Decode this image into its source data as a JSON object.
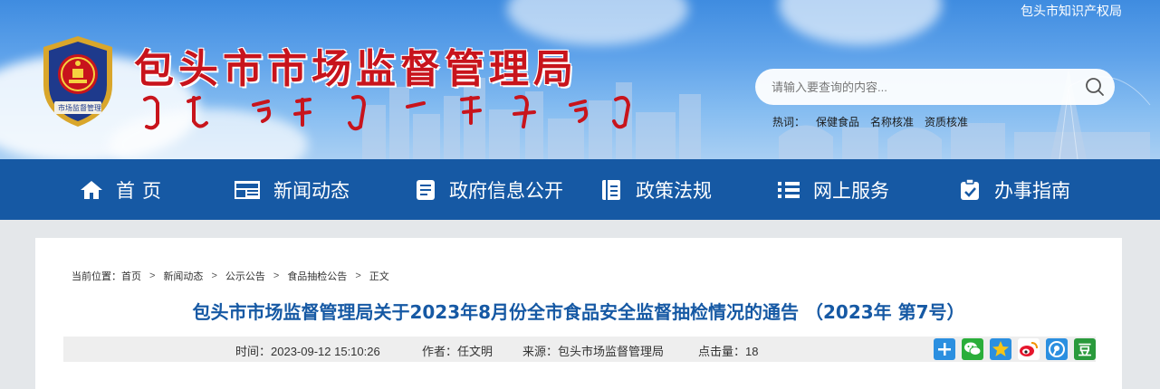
{
  "header": {
    "site_title": "包头市市场监督管理局",
    "emblem_caption": "市场监督管理",
    "ip_link": "包头市知识产权局",
    "search": {
      "placeholder": "请输入要查询的内容..."
    },
    "hotwords": {
      "label": "热词：",
      "items": [
        "保健食品",
        "名称核准",
        "资质核准"
      ]
    }
  },
  "nav": {
    "items": [
      {
        "label": "首页",
        "icon": "home-icon"
      },
      {
        "label": "新闻动态",
        "icon": "news-icon"
      },
      {
        "label": "政府信息公开",
        "icon": "document-icon"
      },
      {
        "label": "政策法规",
        "icon": "book-icon"
      },
      {
        "label": "网上服务",
        "icon": "list-icon"
      },
      {
        "label": "办事指南",
        "icon": "clipboard-icon"
      }
    ]
  },
  "breadcrumb": {
    "label": "当前位置：",
    "items": [
      "首页",
      "新闻动态",
      "公示公告",
      "食品抽检公告",
      "正文"
    ],
    "separator": ">"
  },
  "article": {
    "title": "包头市市场监督管理局关于2023年8月份全市食品安全监督抽检情况的通告 （2023年 第7号）",
    "meta": {
      "time": "时间：2023-09-12 15:10:26",
      "author": "作者：任文明",
      "source": "来源：包头市场监督管理局",
      "clicks": "点击量：18"
    }
  },
  "share": {
    "items": [
      {
        "icon": "plus-share-icon",
        "color": "#2b8fe0"
      },
      {
        "icon": "wechat-icon",
        "color": "#2aae3a"
      },
      {
        "icon": "qzone-star-icon",
        "color": "#2b8fe0"
      },
      {
        "icon": "weibo-icon",
        "color": "#e6162d"
      },
      {
        "icon": "tencent-weibo-icon",
        "color": "#2b8fe0"
      },
      {
        "icon": "douban-icon",
        "color": "#2a9a3c"
      }
    ],
    "douban_glyph": "豆"
  },
  "colors": {
    "brand_red": "#c8141c",
    "nav_blue": "#1659a4",
    "title_blue": "#1659a4"
  }
}
